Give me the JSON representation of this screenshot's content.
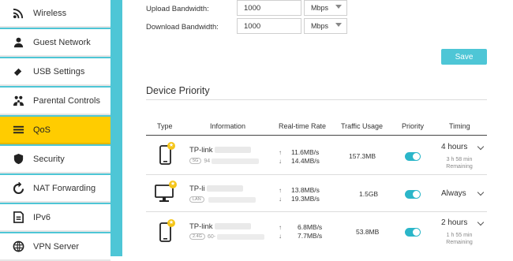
{
  "sidebar": {
    "items": [
      {
        "label": "Wireless",
        "icon": "wifi-icon"
      },
      {
        "label": "Guest Network",
        "icon": "guest-icon"
      },
      {
        "label": "USB Settings",
        "icon": "usb-icon"
      },
      {
        "label": "Parental Controls",
        "icon": "family-icon"
      },
      {
        "label": "QoS",
        "icon": "qos-icon",
        "active": true
      },
      {
        "label": "Security",
        "icon": "shield-icon"
      },
      {
        "label": "NAT Forwarding",
        "icon": "nat-icon"
      },
      {
        "label": "IPv6",
        "icon": "ipv6-icon"
      },
      {
        "label": "VPN Server",
        "icon": "vpn-icon"
      }
    ],
    "accent_color": "#4ec6d6",
    "active_color": "#ffcc00"
  },
  "bandwidth": {
    "upload_label": "Upload Bandwidth:",
    "upload_value": "1000",
    "upload_unit": "Mbps",
    "download_label": "Download Bandwidth:",
    "download_value": "1000",
    "download_unit": "Mbps"
  },
  "save_label": "Save",
  "device_priority": {
    "title": "Device Priority",
    "columns": [
      "Type",
      "Information",
      "Real-time Rate",
      "Traffic Usage",
      "Priority",
      "Timing"
    ],
    "devices": [
      {
        "type": "phone-icon",
        "name": "TP-link",
        "conn": "5G",
        "mac_prefix": "94",
        "up": "11.6MB/s",
        "down": "14.4MB/s",
        "traffic": "157.3MB",
        "priority_on": true,
        "timing": "4 hours",
        "remaining": "3 h 58 min",
        "remaining_label": "Remaining"
      },
      {
        "type": "desktop-icon",
        "name": "TP-li",
        "conn": "LAN",
        "mac_prefix": "",
        "up": "13.8MB/s",
        "down": "19.3MB/s",
        "traffic": "1.5GB",
        "priority_on": true,
        "timing": "Always",
        "remaining": "",
        "remaining_label": ""
      },
      {
        "type": "phone-icon",
        "name": "TP-link",
        "conn": "2.4G",
        "mac_prefix": "60-",
        "up": "6.8MB/s",
        "down": "7.7MB/s",
        "traffic": "53.8MB",
        "priority_on": true,
        "timing": "2 hours",
        "remaining": "1 h 55 min",
        "remaining_label": "Remaining"
      }
    ]
  }
}
